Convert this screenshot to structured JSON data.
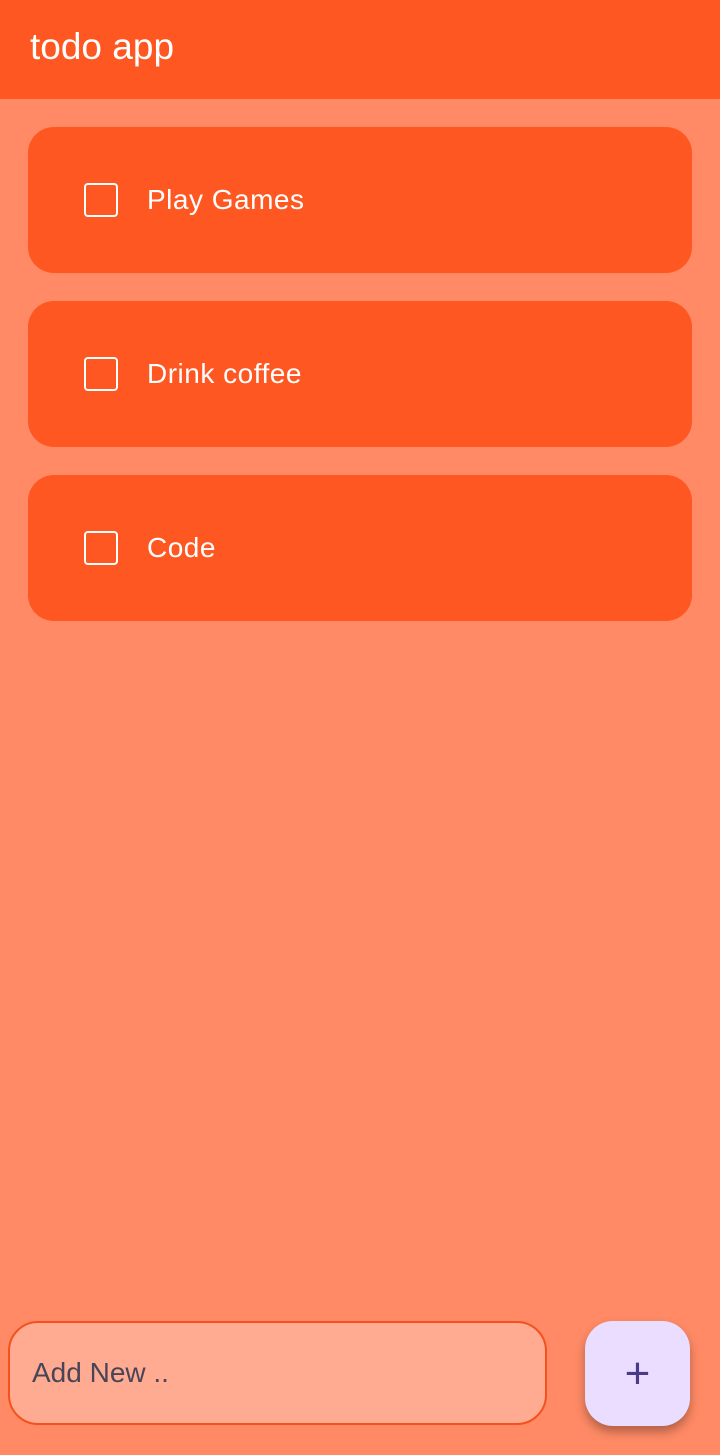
{
  "app": {
    "title": "todo app"
  },
  "todos": [
    {
      "label": "Play Games",
      "checked": false
    },
    {
      "label": "Drink coffee",
      "checked": false
    },
    {
      "label": "Code",
      "checked": false
    }
  ],
  "input": {
    "placeholder": "Add New .."
  },
  "fab": {
    "icon": "plus-icon",
    "glyph": "+"
  }
}
